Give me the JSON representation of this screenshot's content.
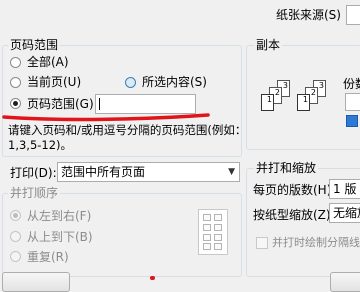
{
  "header": {
    "paper_source_label": "纸张来源(S)"
  },
  "page_range": {
    "group_label": "页码范围",
    "all_label": "全部(A)",
    "current_page_label": "当前页(U)",
    "selection_label": "所选内容(S)",
    "pages_label": "页码范围(G):",
    "pages_value": "",
    "hint_line1": "请键入页码和/或用逗号分隔的页码范围(例如：",
    "hint_line2": "1,3,5-12)。"
  },
  "print_what": {
    "label": "打印(D):",
    "value": "范围中所有页面"
  },
  "print_order": {
    "group_label": "并打顺序",
    "left_to_right": "从左到右(F)",
    "top_to_bottom": "从上到下(B)",
    "repeat": "重复(R)"
  },
  "copies": {
    "group_label": "副本",
    "copies_label_partial": "份数",
    "page_numbers": [
      "1",
      "2",
      "3"
    ]
  },
  "zoom": {
    "group_label": "并打和缩放",
    "pages_per_sheet_label": "每页的版数(H):",
    "pages_per_sheet_value": "1 版",
    "scale_to_paper_label": "按纸型缩放(Z):",
    "scale_to_paper_value": "无缩放",
    "draw_borders_label": "并打时绘制分隔线(L)"
  },
  "colors": {
    "underline": "#e0151b",
    "group_border": "#d5dfe5"
  }
}
